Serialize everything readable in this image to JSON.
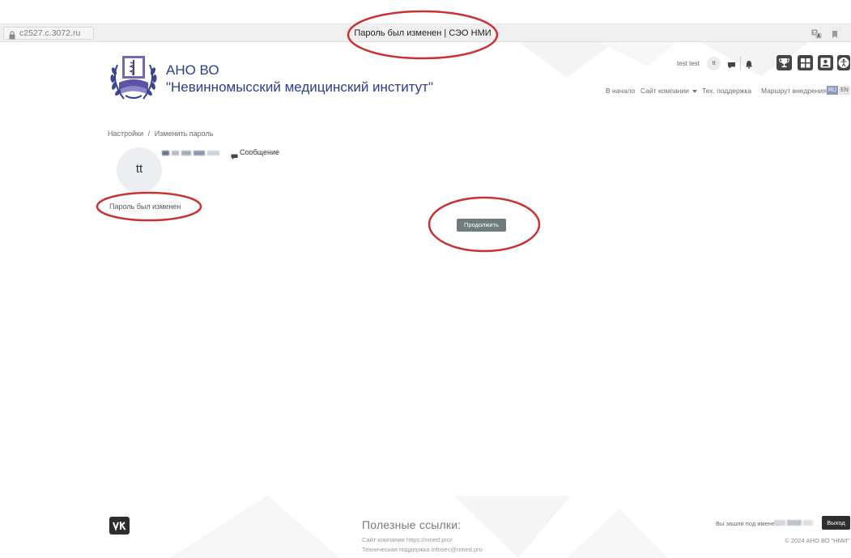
{
  "browser": {
    "url": "c2527.c.3072.ru",
    "tab_title": "Пароль был изменен | СЭО НМИ",
    "icons": [
      "lock-icon",
      "translate-icon",
      "bookmark-icon"
    ]
  },
  "header": {
    "org_line1": "АНО ВО",
    "org_line2": "\"Невинномысский медицинский институт\"",
    "user_name": "test test",
    "user_initials": "tt",
    "nav": {
      "home": "В начало",
      "company_site": "Сайт компании",
      "support": "Тех. поддержка",
      "route": "Маршрут внедрения"
    },
    "languages": [
      "RU",
      "EN"
    ],
    "active_language": "RU",
    "icons": [
      "logo-emblem",
      "chat-icon",
      "bell-icon",
      "trophy-icon",
      "grid-icon",
      "id-card-icon",
      "accessibility-icon",
      "dropdown-caret-icon"
    ]
  },
  "main": {
    "breadcrumb": [
      "Настройки",
      "Изменить пароль"
    ],
    "breadcrumb_separator": "/",
    "avatar_initials": "tt",
    "message_link": "Сообщение",
    "status_message": "Пароль был изменен",
    "continue_button": "Продолжить"
  },
  "footer": {
    "links_title": "Полезные ссылки:",
    "company_site": "Сайт компании https://nmed.pro/",
    "support": "Техническая поддержка infosec@nmed.pro",
    "logged_in_as": "Вы зашли под именем",
    "logout": "Выход",
    "copyright": "© 2024 АНО ВО \"НМИ\"",
    "icons": [
      "vk-icon"
    ]
  },
  "colors": {
    "accent": "#2c3e8f",
    "continue_button": "#6e7c7e",
    "logout_button": "#2f2f2f",
    "header_icon_buttons": "#454545",
    "annotation_ellipse": "#cc2f2f"
  }
}
